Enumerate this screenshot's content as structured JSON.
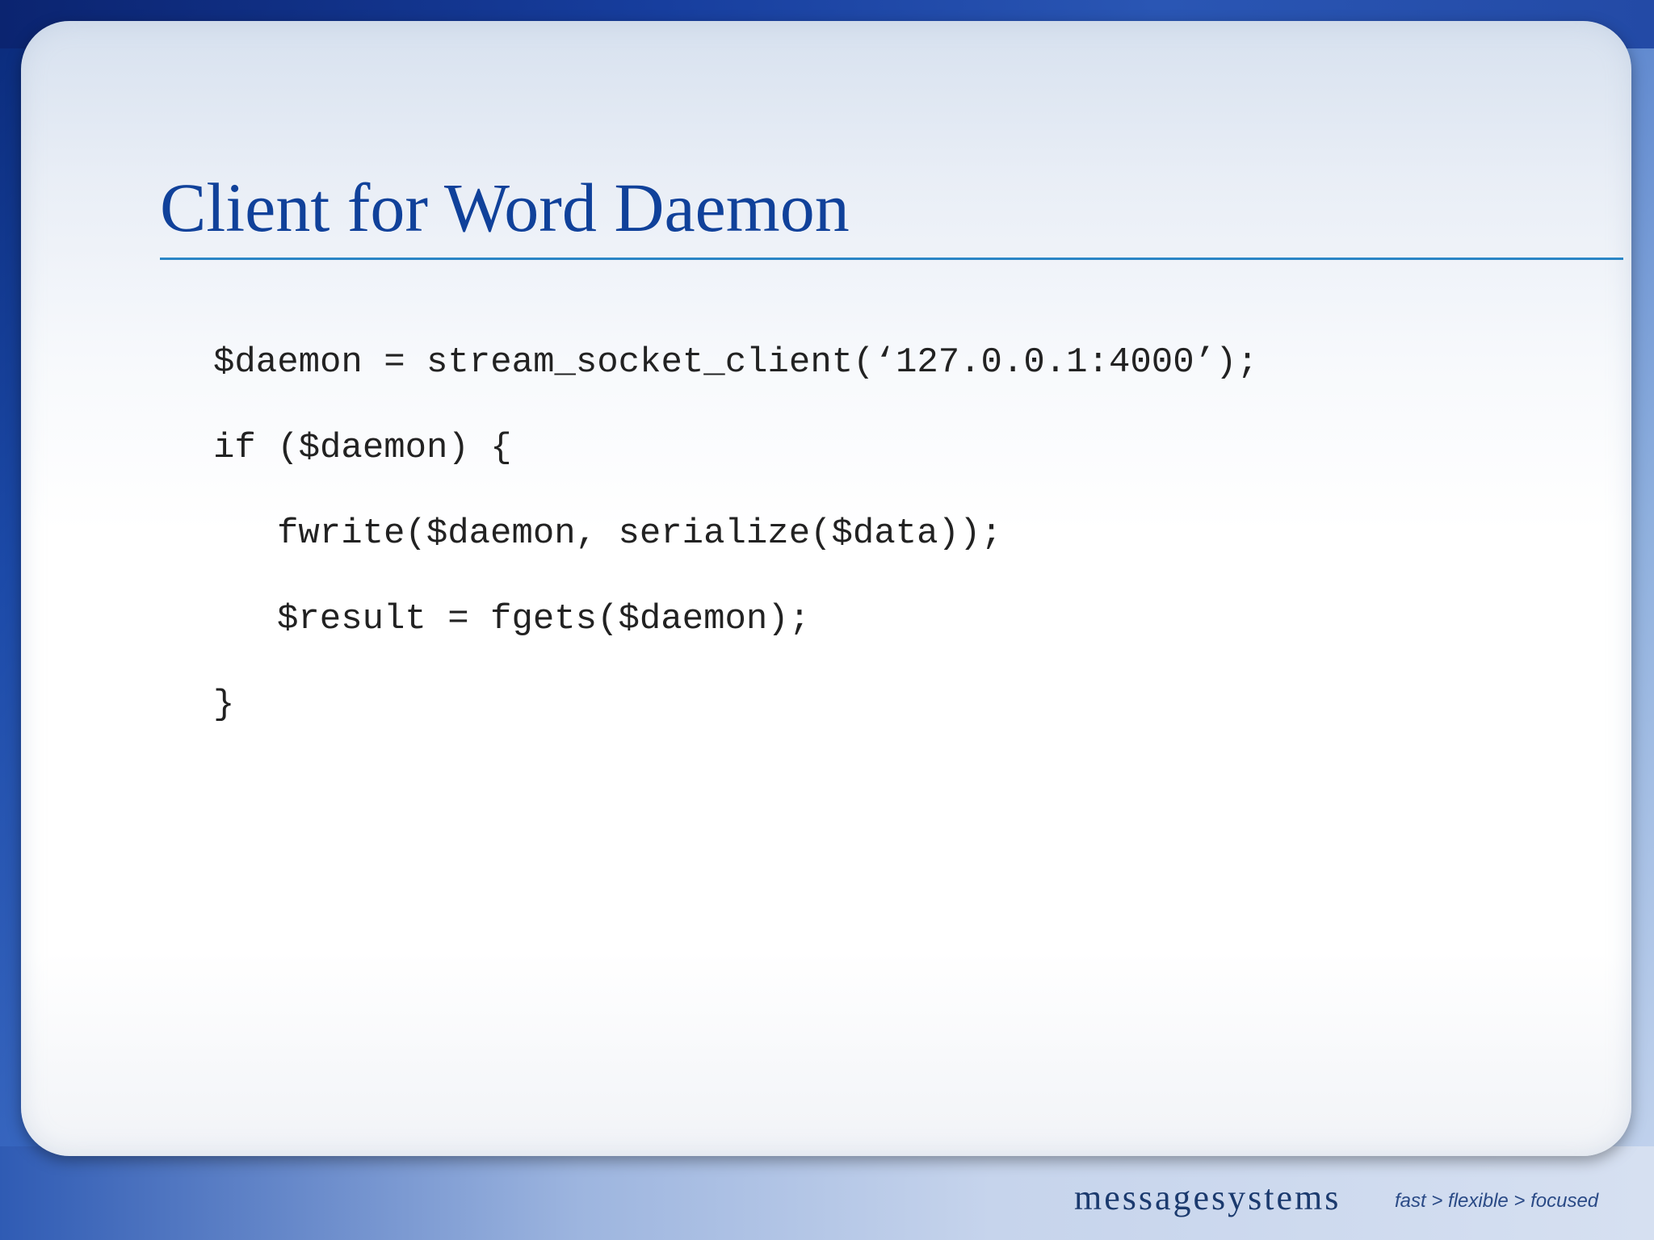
{
  "slide": {
    "title": "Client for Word Daemon",
    "code_lines": [
      {
        "text": "$daemon = stream_socket_client(‘127.0.0.1:4000’);",
        "indent": 0
      },
      {
        "text": "if ($daemon) {",
        "indent": 0
      },
      {
        "text": "fwrite($daemon, serialize($data));",
        "indent": 1
      },
      {
        "text": "$result = fgets($daemon);",
        "indent": 1
      },
      {
        "text": "}",
        "indent": 0
      }
    ]
  },
  "footer": {
    "logo_text": "messagesystems",
    "tagline": "fast > flexible > focused"
  },
  "colors": {
    "title": "#10419a",
    "rule": "#2a86c6",
    "code": "#222222",
    "background_dark": "#0a2a7a"
  }
}
